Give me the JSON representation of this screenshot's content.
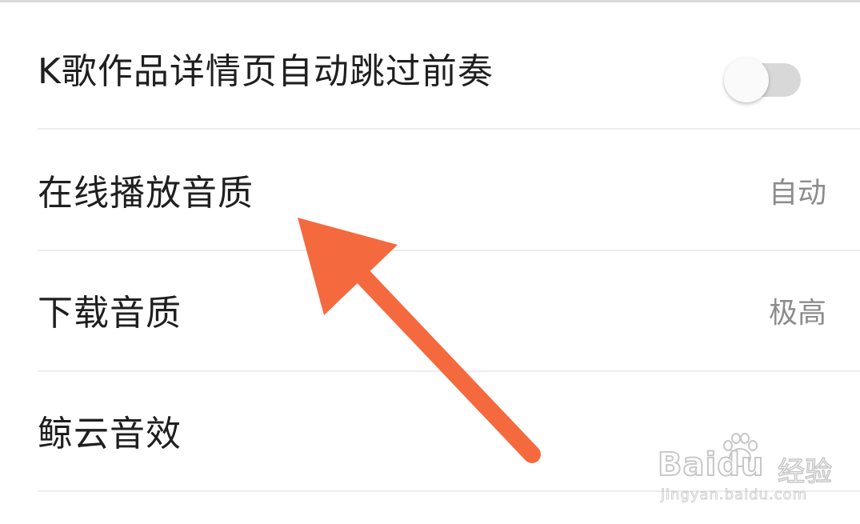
{
  "settings": {
    "rows": [
      {
        "label": "K歌作品详情页自动跳过前奏",
        "control": "toggle",
        "toggle_on": false
      },
      {
        "label": "在线播放音质",
        "value": "自动"
      },
      {
        "label": "下载音质",
        "value": "极高"
      },
      {
        "label": "鲸云音效"
      }
    ]
  },
  "annotation": {
    "arrow_color": "#f4693e"
  },
  "watermark": {
    "brand": "Baidu",
    "product": "经验",
    "url": "jingyan.baidu.com"
  },
  "colors": {
    "label_text": "#1f1f1f",
    "value_text": "#8c8c8c",
    "divider": "#ececec",
    "toggle_track_off": "#d8d8d8"
  }
}
